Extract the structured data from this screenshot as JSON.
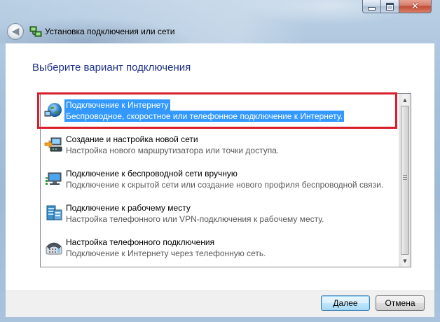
{
  "window": {
    "title": "Установка подключения или сети",
    "caption_buttons": [
      "minimize",
      "maximize",
      "close"
    ]
  },
  "heading": "Выберите вариант подключения",
  "options": [
    {
      "label": "Подключение к Интернету",
      "description": "Беспроводное, скоростное или телефонное подключение к Интернету.",
      "icon": "globe-network-icon",
      "selected": true
    },
    {
      "label": "Создание и настройка новой сети",
      "description": "Настройка нового маршрутизатора или точки доступа.",
      "icon": "router-setup-icon",
      "selected": false
    },
    {
      "label": "Подключение к беспроводной сети вручную",
      "description": "Подключение к скрытой сети или создание нового профиля беспроводной связи.",
      "icon": "wireless-network-icon",
      "selected": false
    },
    {
      "label": "Подключение к рабочему месту",
      "description": "Настройка телефонного или VPN-подключения к рабочему месту.",
      "icon": "workplace-vpn-icon",
      "selected": false
    },
    {
      "label": "Настройка телефонного подключения",
      "description": "Подключение к Интернету через телефонную сеть.",
      "icon": "dialup-phone-icon",
      "selected": false
    }
  ],
  "buttons": {
    "next": "Далее",
    "cancel": "Отмена"
  },
  "colors": {
    "selection": "#3399ff",
    "highlight_border": "#d81e2c",
    "heading": "#1e3287"
  }
}
